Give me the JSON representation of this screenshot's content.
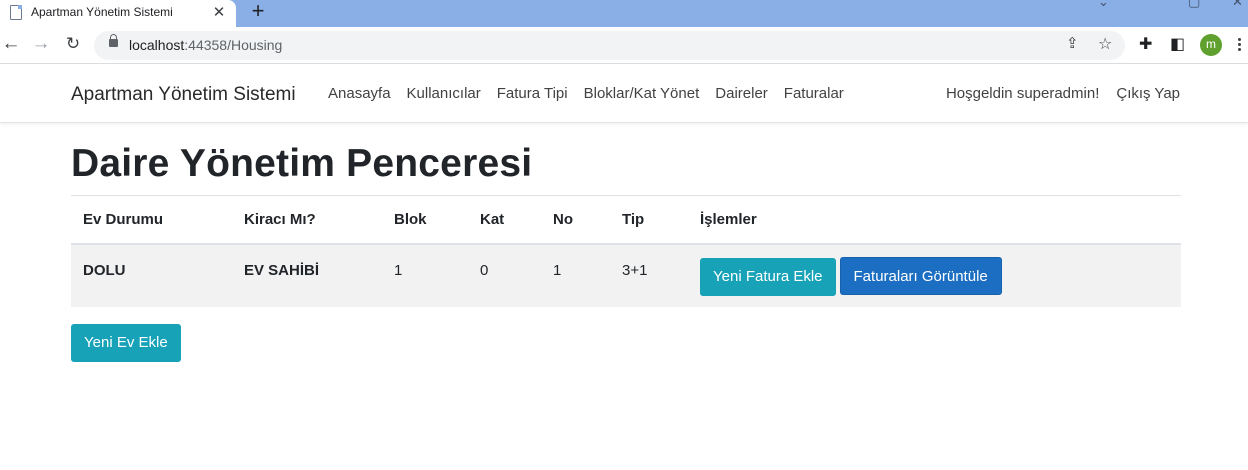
{
  "browser": {
    "tab_title": "Apartman Yönetim Sistemi",
    "new_tab_symbol": "+",
    "close_symbol": "✕",
    "url_host": "localhost",
    "url_path": ":44358/Housing",
    "profile_initial": "m"
  },
  "navbar": {
    "brand": "Apartman Yönetim Sistemi",
    "links": [
      "Anasayfa",
      "Kullanıcılar",
      "Fatura Tipi",
      "Bloklar/Kat Yönet",
      "Daireler",
      "Faturalar"
    ],
    "greeting": "Hoşgeldin superadmin!",
    "logout": "Çıkış Yap"
  },
  "main": {
    "title": "Daire Yönetim Penceresi",
    "table": {
      "headers": [
        "Ev Durumu",
        "Kiracı Mı?",
        "Blok",
        "Kat",
        "No",
        "Tip",
        "İşlemler"
      ],
      "rows": [
        {
          "status": "DOLU",
          "tenant": "EV SAHİBİ",
          "block": "1",
          "floor": "0",
          "no": "1",
          "type": "3+1",
          "add_invoice_label": "Yeni Fatura Ekle",
          "view_invoices_label": "Faturaları Görüntüle"
        }
      ]
    },
    "add_home_label": "Yeni Ev Ekle"
  },
  "colors": {
    "tabstrip": "#8aaee6",
    "info_button": "#17a2b8",
    "primary_button": "#1b6ec2",
    "row_background": "#f2f2f2",
    "profile_avatar": "#5fa02e"
  }
}
